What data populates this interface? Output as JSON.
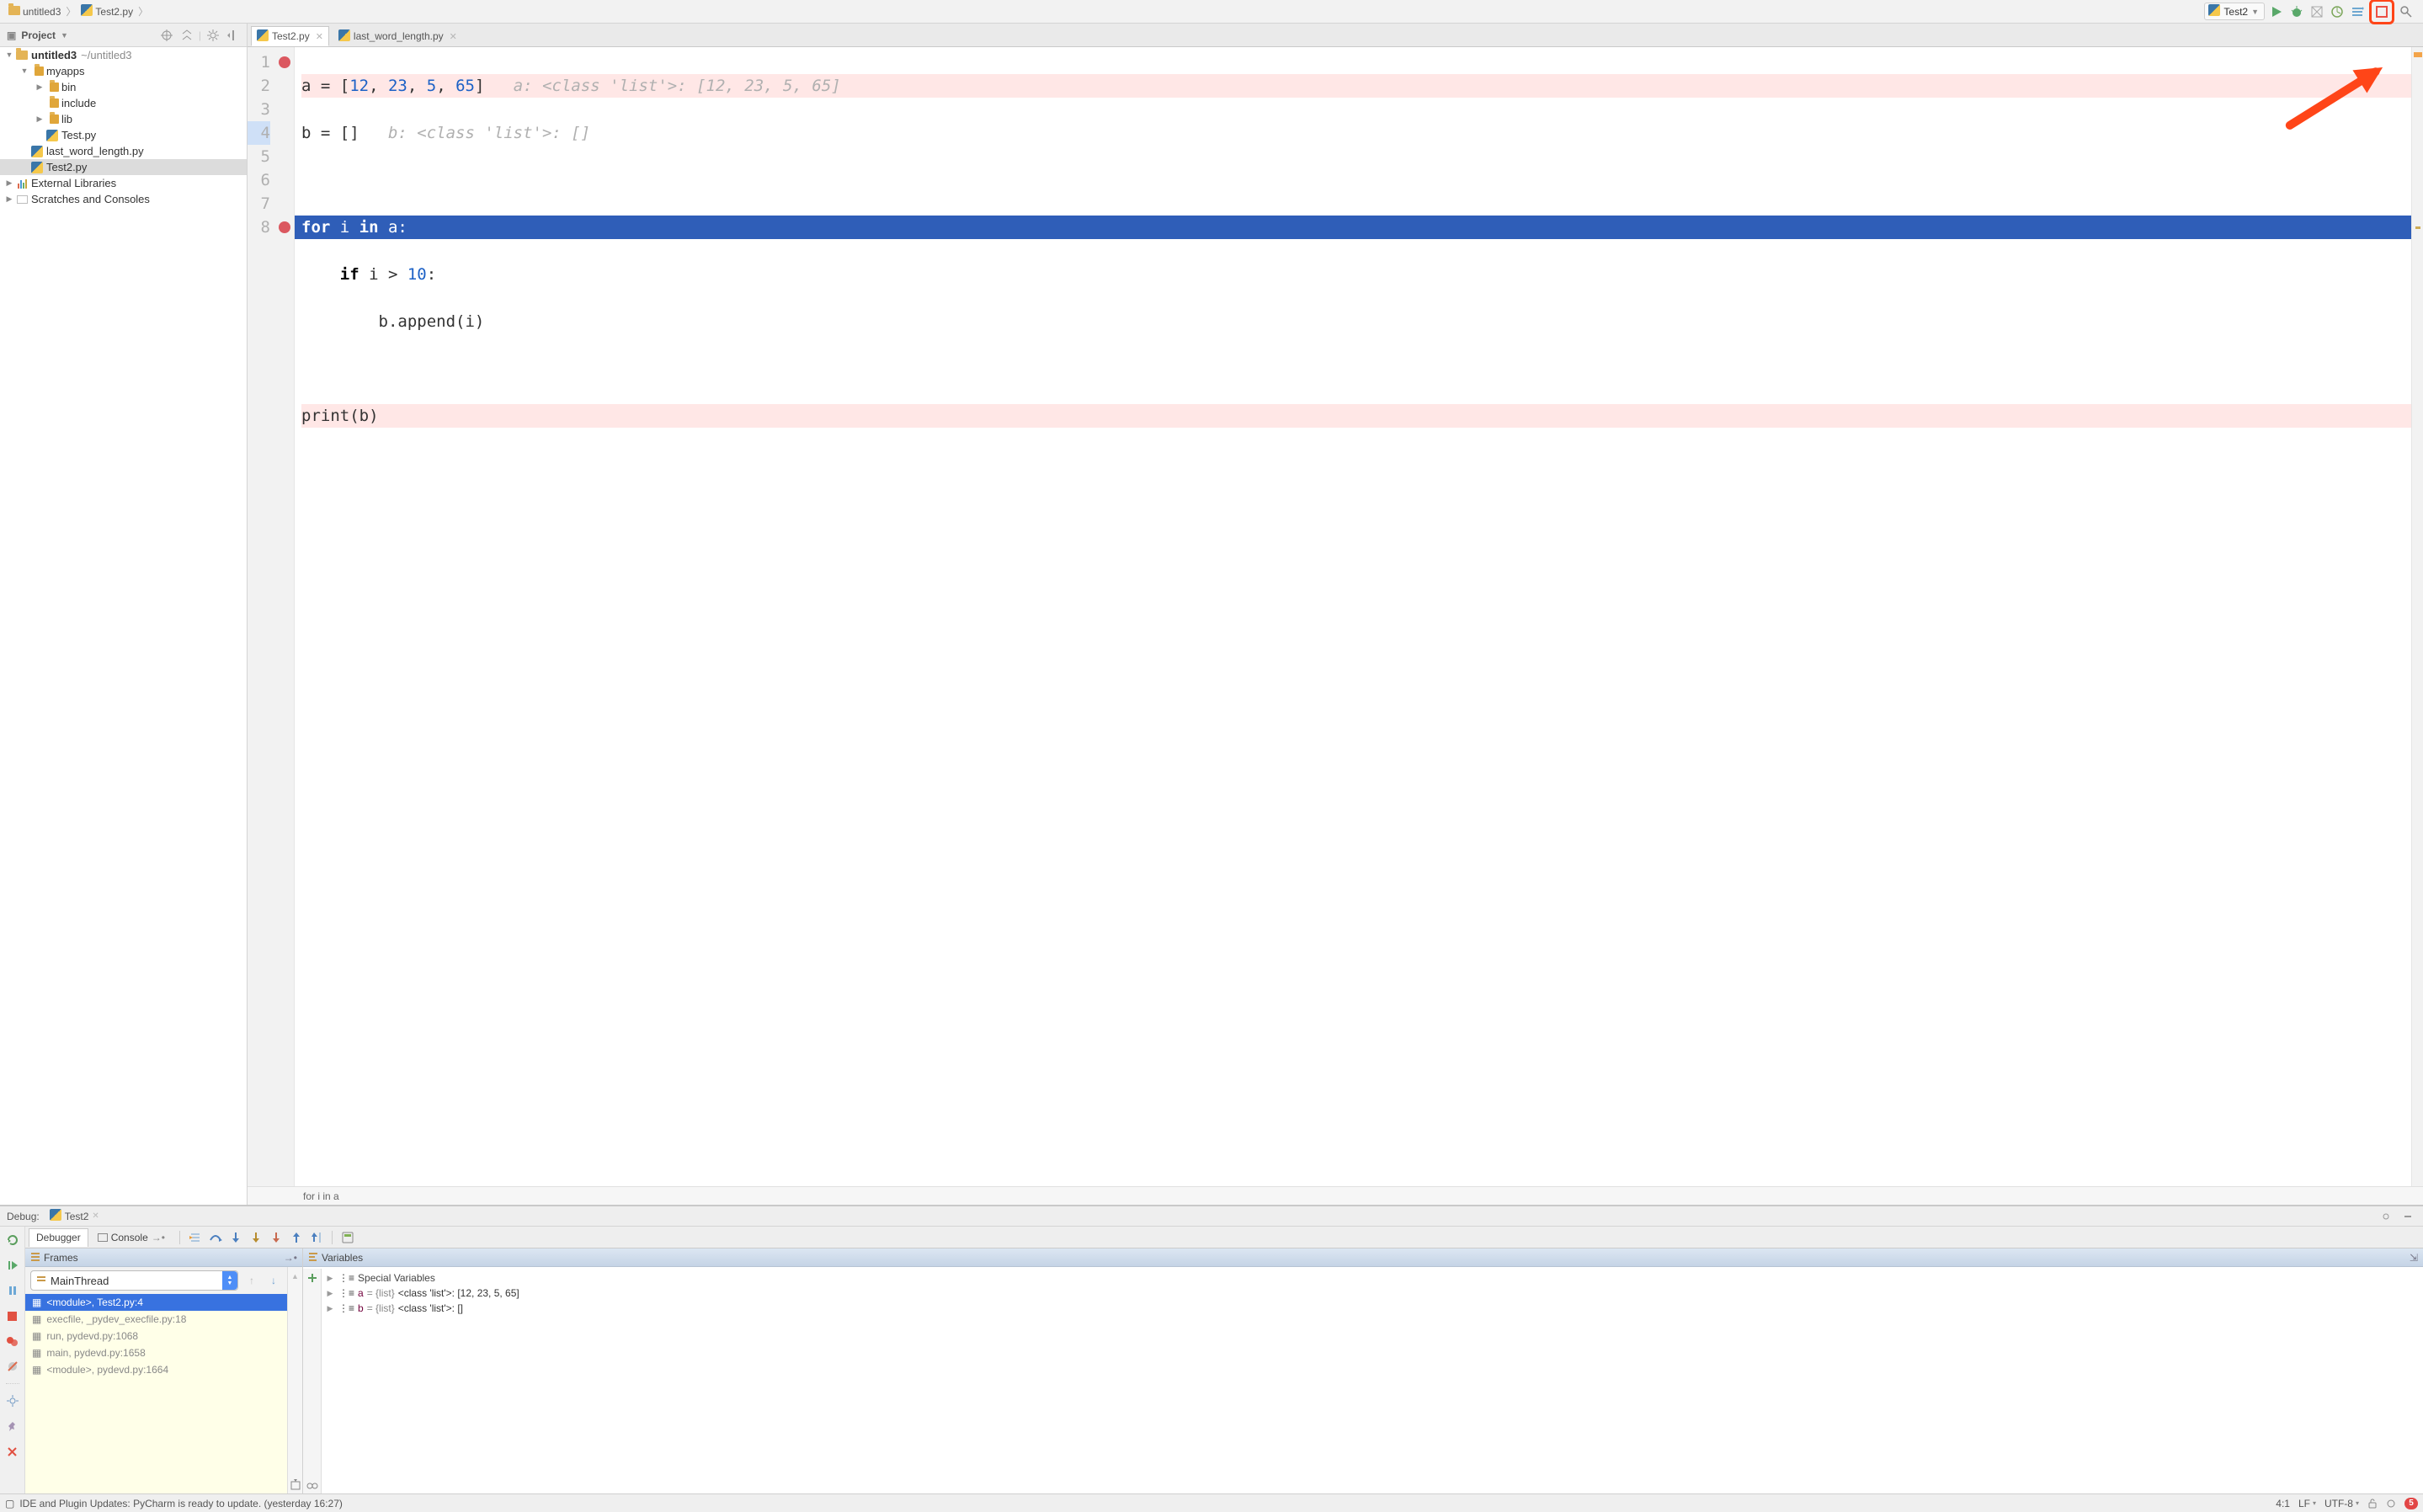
{
  "breadcrumbs": {
    "project": "untitled3",
    "file": "Test2.py"
  },
  "toolbar": {
    "run_config": "Test2"
  },
  "editor": {
    "tabs": [
      {
        "label": "Test2.py",
        "active": true
      },
      {
        "label": "last_word_length.py",
        "active": false
      }
    ],
    "gutter_lines": [
      "1",
      "2",
      "3",
      "4",
      "5",
      "6",
      "7",
      "8"
    ],
    "code": {
      "l1_pre": "a = [",
      "l1_nums": [
        "12",
        "23",
        "5",
        "65"
      ],
      "l1_sep": ", ",
      "l1_post": "]",
      "l1_inlay": "   a: <class 'list'>: [12, 23, 5, 65]",
      "l2": "b = []",
      "l2_inlay": "   b: <class 'list'>: []",
      "l4_kw1": "for",
      "l4_mid": " i ",
      "l4_kw2": "in",
      "l4_end": " a:",
      "l5_indent": "    ",
      "l5_kw": "if",
      "l5_mid": " i > ",
      "l5_num": "10",
      "l5_end": ":",
      "l6": "        b.append(i)",
      "l8": "print(b)"
    },
    "breadcrumb_strip": "for i in a"
  },
  "project_tree": {
    "header": "Project",
    "root_name": "untitled3",
    "root_path": "~/untitled3",
    "myapps": "myapps",
    "bin": "bin",
    "include": "include",
    "lib": "lib",
    "test_py": "Test.py",
    "last_word": "last_word_length.py",
    "test2_py": "Test2.py",
    "external": "External Libraries",
    "scratches": "Scratches and Consoles"
  },
  "debug": {
    "title": "Debug:",
    "config": "Test2",
    "debugger_tab": "Debugger",
    "console_tab": "Console",
    "frames_header": "Frames",
    "variables_header": "Variables",
    "thread": "MainThread",
    "frames": [
      "<module>, Test2.py:4",
      "execfile, _pydev_execfile.py:18",
      "run, pydevd.py:1068",
      "main, pydevd.py:1658",
      "<module>, pydevd.py:1664"
    ],
    "special_vars": "Special Variables",
    "var_a_name": "a",
    "var_a_type": " = {list} ",
    "var_a_val": "<class 'list'>: [12, 23, 5, 65]",
    "var_b_name": "b",
    "var_b_type": " = {list} ",
    "var_b_val": "<class 'list'>: []"
  },
  "status": {
    "msg": "IDE and Plugin Updates: PyCharm is ready to update. (yesterday 16:27)",
    "pos": "4:1",
    "le": "LF",
    "enc": "UTF-8",
    "notif": "5"
  }
}
